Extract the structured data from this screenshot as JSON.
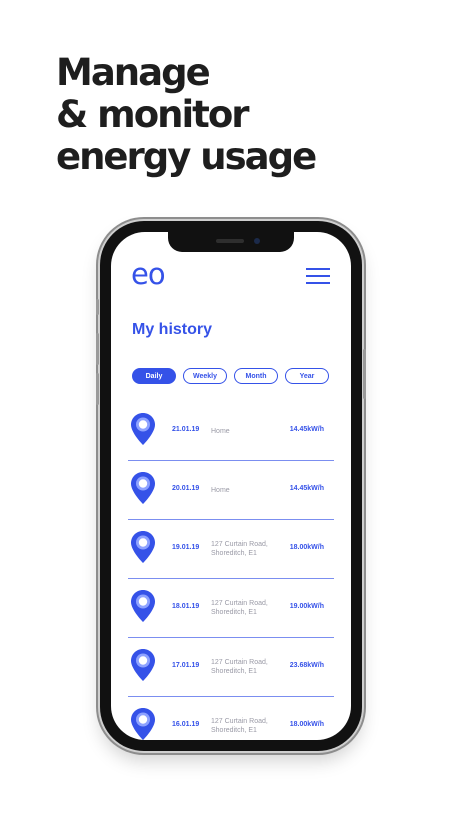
{
  "headline": [
    "Manage",
    "& monitor",
    "energy usage"
  ],
  "app": {
    "logo": "eo",
    "menu_icon": "hamburger-menu-icon",
    "title": "My history",
    "tabs": [
      {
        "label": "Daily",
        "active": true
      },
      {
        "label": "Weekly",
        "active": false
      },
      {
        "label": "Month",
        "active": false
      },
      {
        "label": "Year",
        "active": false
      }
    ],
    "history": [
      {
        "date": "21.01.19",
        "location_line1": "Home",
        "location_line2": "",
        "energy": "14.45kW/h"
      },
      {
        "date": "20.01.19",
        "location_line1": "Home",
        "location_line2": "",
        "energy": "14.45kW/h"
      },
      {
        "date": "19.01.19",
        "location_line1": "127 Curtain Road,",
        "location_line2": "Shoreditch, E1",
        "energy": "18.00kW/h"
      },
      {
        "date": "18.01.19",
        "location_line1": "127 Curtain Road,",
        "location_line2": "Shoreditch, E1",
        "energy": "19.00kW/h"
      },
      {
        "date": "17.01.19",
        "location_line1": "127 Curtain Road,",
        "location_line2": "Shoreditch, E1",
        "energy": "23.68kW/h"
      },
      {
        "date": "16.01.19",
        "location_line1": "127 Curtain Road,",
        "location_line2": "Shoreditch, E1",
        "energy": "18.00kW/h"
      }
    ]
  },
  "colors": {
    "accent": "#3552e8",
    "pin_light": "#8ea2ff",
    "text_dark": "#1e1e1e",
    "muted": "#9a9aa6"
  }
}
